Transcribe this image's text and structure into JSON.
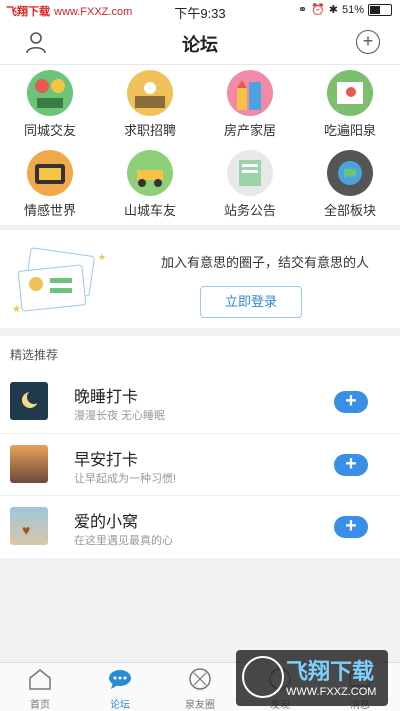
{
  "status_bar": {
    "brand": "飞翔下载",
    "url": "www.FXXZ.com",
    "time": "下午9:33",
    "battery": "51%",
    "battery_level": 0.51
  },
  "header": {
    "title": "论坛"
  },
  "categories": [
    {
      "label": "同城交友",
      "icon": "friends-icon"
    },
    {
      "label": "求职招聘",
      "icon": "job-icon"
    },
    {
      "label": "房产家居",
      "icon": "house-icon"
    },
    {
      "label": "吃遍阳泉",
      "icon": "food-map-icon"
    },
    {
      "label": "情感世界",
      "icon": "emotion-icon"
    },
    {
      "label": "山城车友",
      "icon": "car-icon"
    },
    {
      "label": "站务公告",
      "icon": "announcement-icon"
    },
    {
      "label": "全部板块",
      "icon": "globe-icon"
    }
  ],
  "banner": {
    "text": "加入有意思的圈子，结交有意思的人",
    "login_label": "立即登录"
  },
  "featured": {
    "heading": "精选推荐",
    "items": [
      {
        "name": "晚睡打卡",
        "desc": "漫漫长夜 无心睡眠"
      },
      {
        "name": "早安打卡",
        "desc": "让早起成为一种习惯!"
      },
      {
        "name": "爱的小窝",
        "desc": "在这里遇见最真的心"
      }
    ]
  },
  "tabs": [
    {
      "label": "首页",
      "icon": "home-icon"
    },
    {
      "label": "论坛",
      "icon": "chat-icon",
      "active": true
    },
    {
      "label": "泉友圈",
      "icon": "circle-icon"
    },
    {
      "label": "发现",
      "icon": "discover-icon"
    },
    {
      "label": "消息",
      "icon": "message-icon"
    }
  ],
  "watermark": {
    "title": "飞翔下载",
    "url": "WWW.FXXZ.COM"
  },
  "colors": {
    "accent": "#3a8ee6",
    "login_text": "#2a8ad4",
    "brand_red": "#e02020"
  }
}
